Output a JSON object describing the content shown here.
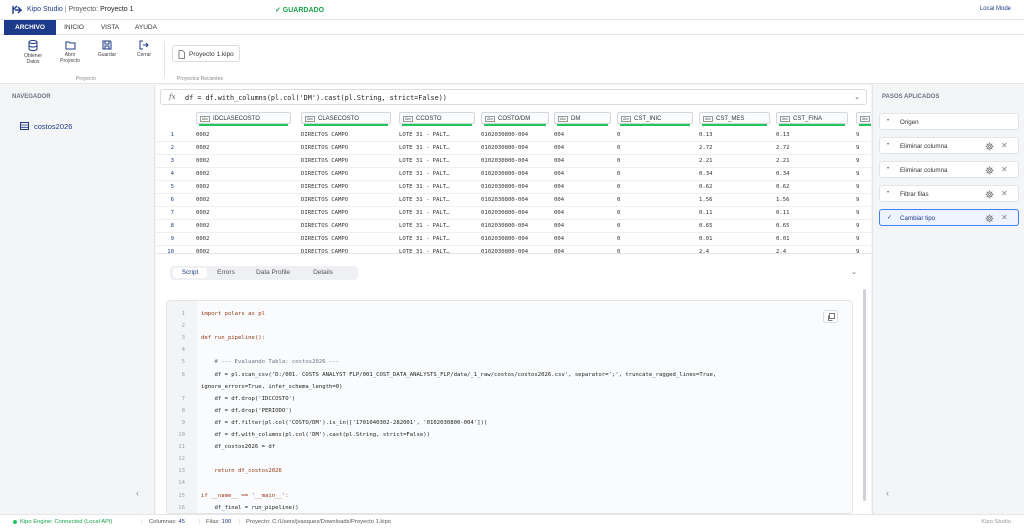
{
  "titlebar": {
    "app_name": "Kipo Studio",
    "project_label": "Proyecto:",
    "project_name": "Proyecto 1",
    "saved_status": "✓ GUARDADO",
    "mode": "Local Mode"
  },
  "menu": {
    "tabs": [
      "ARCHIVO",
      "INICIO",
      "VISTA",
      "AYUDA"
    ],
    "active": "ARCHIVO"
  },
  "ribbon": {
    "buttons": [
      {
        "label": "Obtener Datos",
        "icon": "database-icon"
      },
      {
        "label": "Abrir Proyecto",
        "icon": "folder-icon"
      },
      {
        "label": "Guardar",
        "icon": "save-icon"
      },
      {
        "label": "Cerrar",
        "icon": "logout-icon"
      }
    ],
    "group_label": "Proyecto",
    "recent_file": "Proyecto 1.kipo",
    "recent_label": "Proyectos Recientes"
  },
  "navigator": {
    "title": "NAVEGADOR",
    "items": [
      {
        "label": "costos2026",
        "icon": "table-icon"
      }
    ]
  },
  "formula_bar": {
    "fx": "fx",
    "expression": "df = df.with_columns(pl.col('DM').cast(pl.String, strict=False))"
  },
  "grid": {
    "columns": [
      {
        "type": "Abc",
        "name": "IDCLASECOSTO"
      },
      {
        "type": "Abc",
        "name": "CLASECOSTO"
      },
      {
        "type": "Abc",
        "name": "CCOSTO"
      },
      {
        "type": "Abc",
        "name": "COSTO/DM"
      },
      {
        "type": "Abc",
        "name": "DM"
      },
      {
        "type": "Abc",
        "name": "CST_INIC"
      },
      {
        "type": "Abc",
        "name": "CST_MES"
      },
      {
        "type": "Abc",
        "name": "CST_FINA"
      },
      {
        "type": "Abc",
        "name": ""
      }
    ],
    "rows": [
      [
        "1",
        "0002",
        "DIRECTOS CAMPO",
        "LOTE 31 - PALT…",
        "0102030800-004",
        "004",
        "0",
        "0.13",
        "0.13",
        "9"
      ],
      [
        "2",
        "0002",
        "DIRECTOS CAMPO",
        "LOTE 31 - PALT…",
        "0102030800-004",
        "004",
        "0",
        "2.72",
        "2.72",
        "9"
      ],
      [
        "3",
        "0002",
        "DIRECTOS CAMPO",
        "LOTE 31 - PALT…",
        "0102030800-004",
        "004",
        "0",
        "2.21",
        "2.21",
        "9"
      ],
      [
        "4",
        "0002",
        "DIRECTOS CAMPO",
        "LOTE 31 - PALT…",
        "0102030800-004",
        "004",
        "0",
        "0.34",
        "0.34",
        "9"
      ],
      [
        "5",
        "0002",
        "DIRECTOS CAMPO",
        "LOTE 31 - PALT…",
        "0102030800-004",
        "004",
        "0",
        "0.62",
        "0.62",
        "9"
      ],
      [
        "6",
        "0002",
        "DIRECTOS CAMPO",
        "LOTE 31 - PALT…",
        "0102030800-004",
        "004",
        "0",
        "1.56",
        "1.56",
        "9"
      ],
      [
        "7",
        "0002",
        "DIRECTOS CAMPO",
        "LOTE 31 - PALT…",
        "0102030800-004",
        "004",
        "0",
        "0.11",
        "0.11",
        "9"
      ],
      [
        "8",
        "0002",
        "DIRECTOS CAMPO",
        "LOTE 31 - PALT…",
        "0102030800-004",
        "004",
        "0",
        "0.65",
        "0.65",
        "9"
      ],
      [
        "9",
        "0002",
        "DIRECTOS CAMPO",
        "LOTE 31 - PALT…",
        "0102030800-004",
        "004",
        "0",
        "0.01",
        "0.01",
        "9"
      ],
      [
        "10",
        "0002",
        "DIRECTOS CAMPO",
        "LOTE 31 - PALT…",
        "0102030800-004",
        "004",
        "0",
        "2.4",
        "2.4",
        "9"
      ]
    ]
  },
  "bottom_tabs": {
    "tabs": [
      "Script",
      "Errors",
      "Data Profile",
      "Details"
    ],
    "active": "Script"
  },
  "script": {
    "lines": [
      "import polars as pl",
      "",
      "def run_pipeline():",
      "",
      "    # --- Evaluando Tabla: costos2026 ---",
      "    df = pl.scan_csv('D:/001. COSTS ANALYST FLP/001_COST_DATA_ANALYSTS_FLP/data/_1_raw/costos/costos2026.csv', separator=';', truncate_ragged_lines=True,",
      "ignore_errors=True, infer_schema_length=0)",
      "    df = df.drop('IDCCOSTO')",
      "    df = df.drop('PERIODO')",
      "    df = df.filter(pl.col('COSTO/DM').is_in(['1701040302-282001', '0102030800-004']))",
      "    df = df.with_columns(pl.col('DM').cast(pl.String, strict=False))",
      "    df_costos2026 = df",
      "",
      "    return df_costos2026",
      "",
      "if __name__ == '__main__':",
      "    df_final = run_pipeline()"
    ],
    "line_numbers": [
      "1",
      "2",
      "3",
      "4",
      "5",
      "6",
      "",
      "7",
      "8",
      "9",
      "10",
      "11",
      "12",
      "13",
      "14",
      "15",
      "16",
      "17"
    ]
  },
  "applied_steps": {
    "title": "PASOS APLICADOS",
    "steps": [
      {
        "label": "Origen",
        "active": false
      },
      {
        "label": "Eliminar columna",
        "active": false
      },
      {
        "label": "Eliminar columna",
        "active": false
      },
      {
        "label": "Filtrar filas",
        "active": false
      },
      {
        "label": "Cambiar tipo",
        "active": true
      }
    ]
  },
  "status": {
    "engine": "Kipo Engine: Connected (Local API)",
    "columns_label": "Columnas:",
    "columns_value": "45",
    "rows_label": "Filas:",
    "rows_value": "100",
    "project_path_label": "Proyecto:",
    "project_path": "C:/Users/jvasquez/Downloads/Proyecto 1.kipo",
    "brand": "Kipo Studio"
  },
  "colors": {
    "primary": "#1e3a8a",
    "success": "#16a34a",
    "accent": "#3b82f6",
    "quality_bar": "#22c55e"
  }
}
